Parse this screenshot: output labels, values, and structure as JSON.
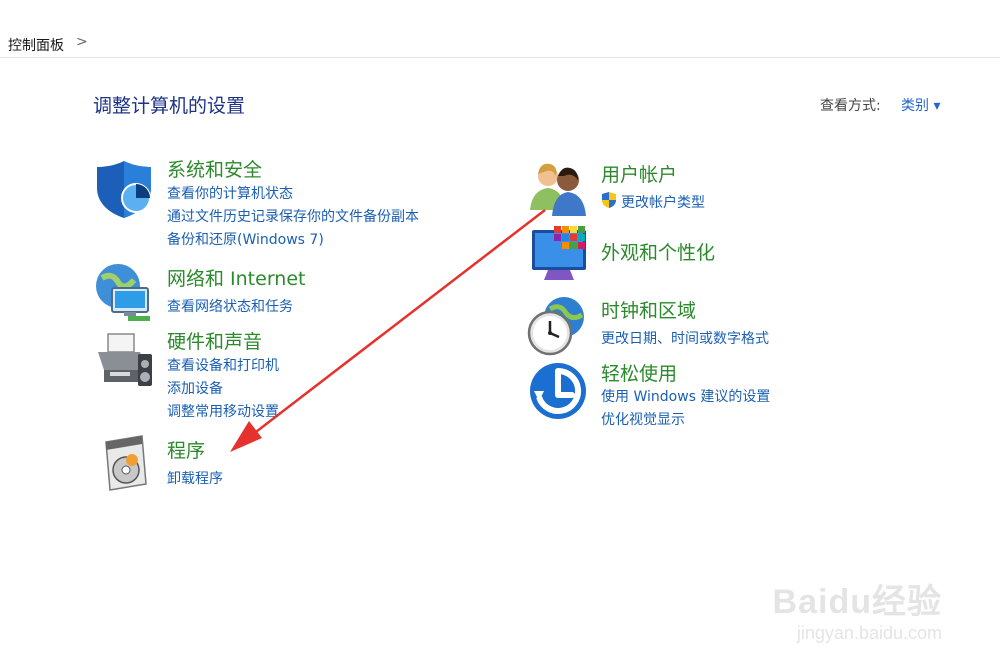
{
  "breadcrumb": {
    "root": "控制面板",
    "separator": ">"
  },
  "page_title": "调整计算机的设置",
  "view_by": {
    "label": "查看方式:",
    "value": "类别 ▾"
  },
  "left_column": {
    "system": {
      "title": "系统和安全",
      "links": [
        "查看你的计算机状态",
        "通过文件历史记录保存你的文件备份副本",
        "备份和还原(Windows 7)"
      ]
    },
    "network": {
      "title": "网络和 Internet",
      "links": [
        "查看网络状态和任务"
      ]
    },
    "hardware": {
      "title": "硬件和声音",
      "links": [
        "查看设备和打印机",
        "添加设备",
        "调整常用移动设置"
      ]
    },
    "programs": {
      "title": "程序",
      "links": [
        "卸载程序"
      ]
    }
  },
  "right_column": {
    "users": {
      "title": "用户帐户",
      "links": [
        "更改帐户类型"
      ]
    },
    "appearance": {
      "title": "外观和个性化",
      "links": []
    },
    "clock": {
      "title": "时钟和区域",
      "links": [
        "更改日期、时间或数字格式"
      ]
    },
    "ease": {
      "title": "轻松使用",
      "links": [
        "使用 Windows 建议的设置",
        "优化视觉显示"
      ]
    }
  },
  "watermark": {
    "brand": "Baidu经验",
    "url": "jingyan.baidu.com"
  },
  "colors": {
    "title_blue": "#1e3287",
    "category_green": "#2b8a2b",
    "link_blue": "#1a5fb4",
    "annotation_red": "#e5322d"
  }
}
